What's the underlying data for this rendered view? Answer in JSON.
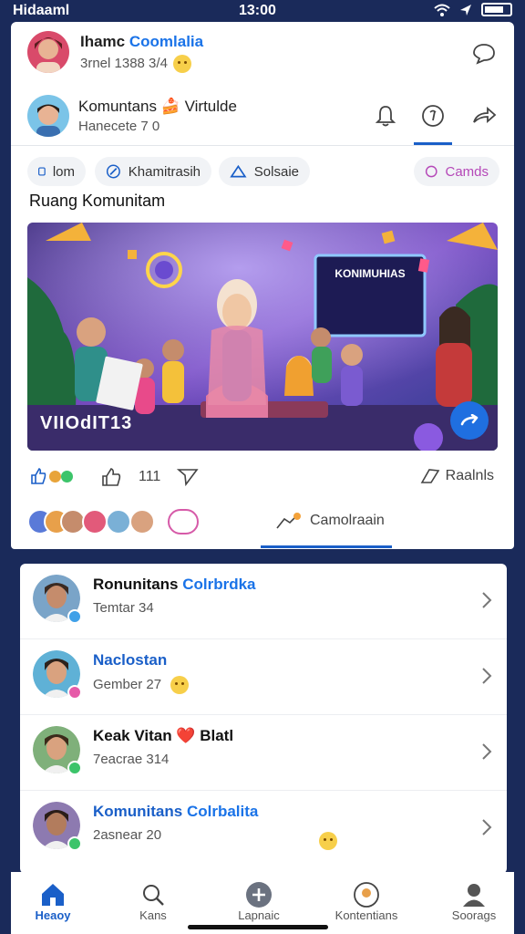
{
  "status_bar": {
    "carrier": "Hidaaml",
    "signal": "ᛒ",
    "time": "13:00",
    "right_label": ""
  },
  "post_header": {
    "name_plain": "Ihamc ",
    "name_highlight": "Coomlalia",
    "meta": "3rnel 1388 3/4",
    "comment_icon": "chat-bubble-icon"
  },
  "community_header": {
    "title": "Komuntans 🍰 Virtulde",
    "meta": "Hanecete 7 0",
    "icons": [
      "bell-icon",
      "at-icon",
      "share-icon"
    ]
  },
  "chips": [
    {
      "label": "lom",
      "icon": "square-icon"
    },
    {
      "label": "Khamitrasih",
      "icon": "edit-icon"
    },
    {
      "label": "Solsaie",
      "icon": "tag-icon"
    },
    {
      "label": "Camds",
      "icon": "ring-icon"
    }
  ],
  "section_title": "Ruang Komunitam",
  "hero": {
    "label": "VIIOdIT13",
    "board_text": "KONIMUHIAS",
    "fab_icon": "share-arrow-icon"
  },
  "actions": {
    "count": "111",
    "save_label": "Raalnls"
  },
  "reactions": {
    "comment_label": "Camolraain"
  },
  "community_list": [
    {
      "title_plain": "Ronunitans ",
      "title_highlight": "Colrbrdka",
      "subtitle": "Temtar 34",
      "title_color": "#111111",
      "badge_color": "#3fa0e8",
      "skin": "#c58c6c",
      "hair": "#3a2a22",
      "bg": "#7aa4c8"
    },
    {
      "title_plain": "Naclostan",
      "title_highlight": "",
      "subtitle": "Gember 27",
      "title_color": "#1a5fc8",
      "badge_color": "#e65aa8",
      "skin": "#d9a27f",
      "hair": "#2d221c",
      "bg": "#5fb1d6"
    },
    {
      "title_plain": "Keak Vitan ❤️ Blatl",
      "title_highlight": "",
      "subtitle": "7eacrae 314",
      "title_color": "#111111",
      "badge_color": "#3cc46a",
      "skin": "#d9a27f",
      "hair": "#3b2a1a",
      "bg": "#7fb07a"
    },
    {
      "title_plain": "Komunitans ",
      "title_highlight": "Colrbalita",
      "subtitle": "2asnear 20",
      "title_color": "#1a5fc8",
      "badge_color": "#3cc46a",
      "skin": "#b27c5d",
      "hair": "#2a1d18",
      "bg": "#8d7ab0"
    }
  ],
  "tabbar": [
    {
      "label": "Heaoy",
      "icon": "home-icon",
      "active": true
    },
    {
      "label": "Kans",
      "icon": "search-icon",
      "active": false
    },
    {
      "label": "Lapnaic",
      "icon": "plus-circle-icon",
      "active": false
    },
    {
      "label": "Kontentians",
      "icon": "community-icon",
      "active": false
    },
    {
      "label": "Soorags",
      "icon": "profile-icon",
      "active": false
    }
  ]
}
